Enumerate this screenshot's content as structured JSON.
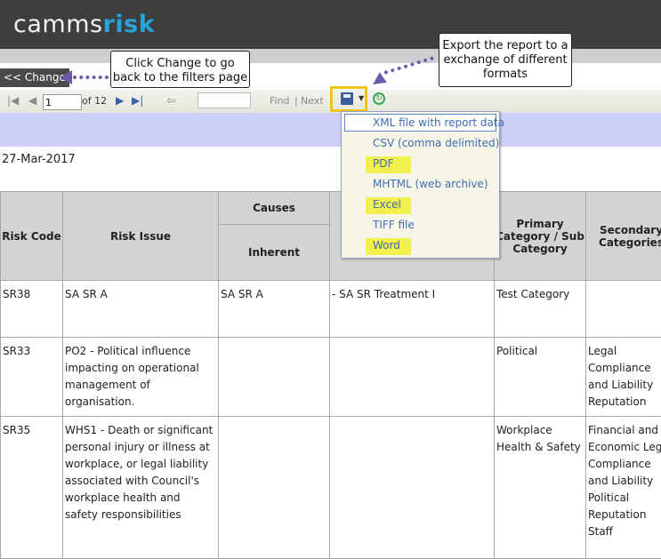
{
  "app": {
    "logo_plain": "camms",
    "logo_accent": "risk"
  },
  "nav": {
    "change_label": "<< Change"
  },
  "toolbar": {
    "page_value": "1",
    "page_total": "of 12",
    "find_label": "Find",
    "separator": "|",
    "next_label": "Next"
  },
  "report": {
    "date": "27-Mar-2017"
  },
  "export_menu": {
    "items": [
      "XML file with report data",
      "CSV (comma delimited)",
      "PDF",
      "MHTML (web archive)",
      "Excel",
      "TIFF file",
      "Word"
    ],
    "highlight_color": "#f2f04d"
  },
  "table": {
    "group_headers": {
      "causes": "Causes"
    },
    "headers": [
      "Risk Code",
      "Risk Issue",
      "Inherent",
      "Primary Category / Sub Category",
      "Secondary Categories"
    ],
    "rows": [
      {
        "code": "SR38",
        "issue": "SA SR A",
        "inherent": "SA SR A",
        "treatment": "- SA SR Treatment I",
        "primary": "Test Category",
        "secondary": ""
      },
      {
        "code": "SR33",
        "issue": "PO2 - Political influence impacting on operational management of organisation.",
        "inherent": "",
        "treatment": "",
        "primary": "Political",
        "secondary": "Legal Compliance and Liability Reputation"
      },
      {
        "code": "SR35",
        "issue": "WHS1 - Death or significant personal injury or illness at workplace, or legal liability associated with Council's workplace health and safety responsibilities",
        "inherent": "",
        "treatment": "",
        "primary": "Workplace Health & Safety",
        "secondary": "Financial and Economic Legal Compliance and Liability Political Reputation Staff"
      }
    ]
  },
  "callouts": {
    "change_note": "Click Change to go back to the filters page",
    "export_note": "Export the report to a exchange of different formats"
  },
  "colors": {
    "header_bg": "#3e3e3e",
    "accent": "#2aa3d8",
    "callout_highlight": "#f4c21c",
    "arrow": "#6b5ba6"
  }
}
